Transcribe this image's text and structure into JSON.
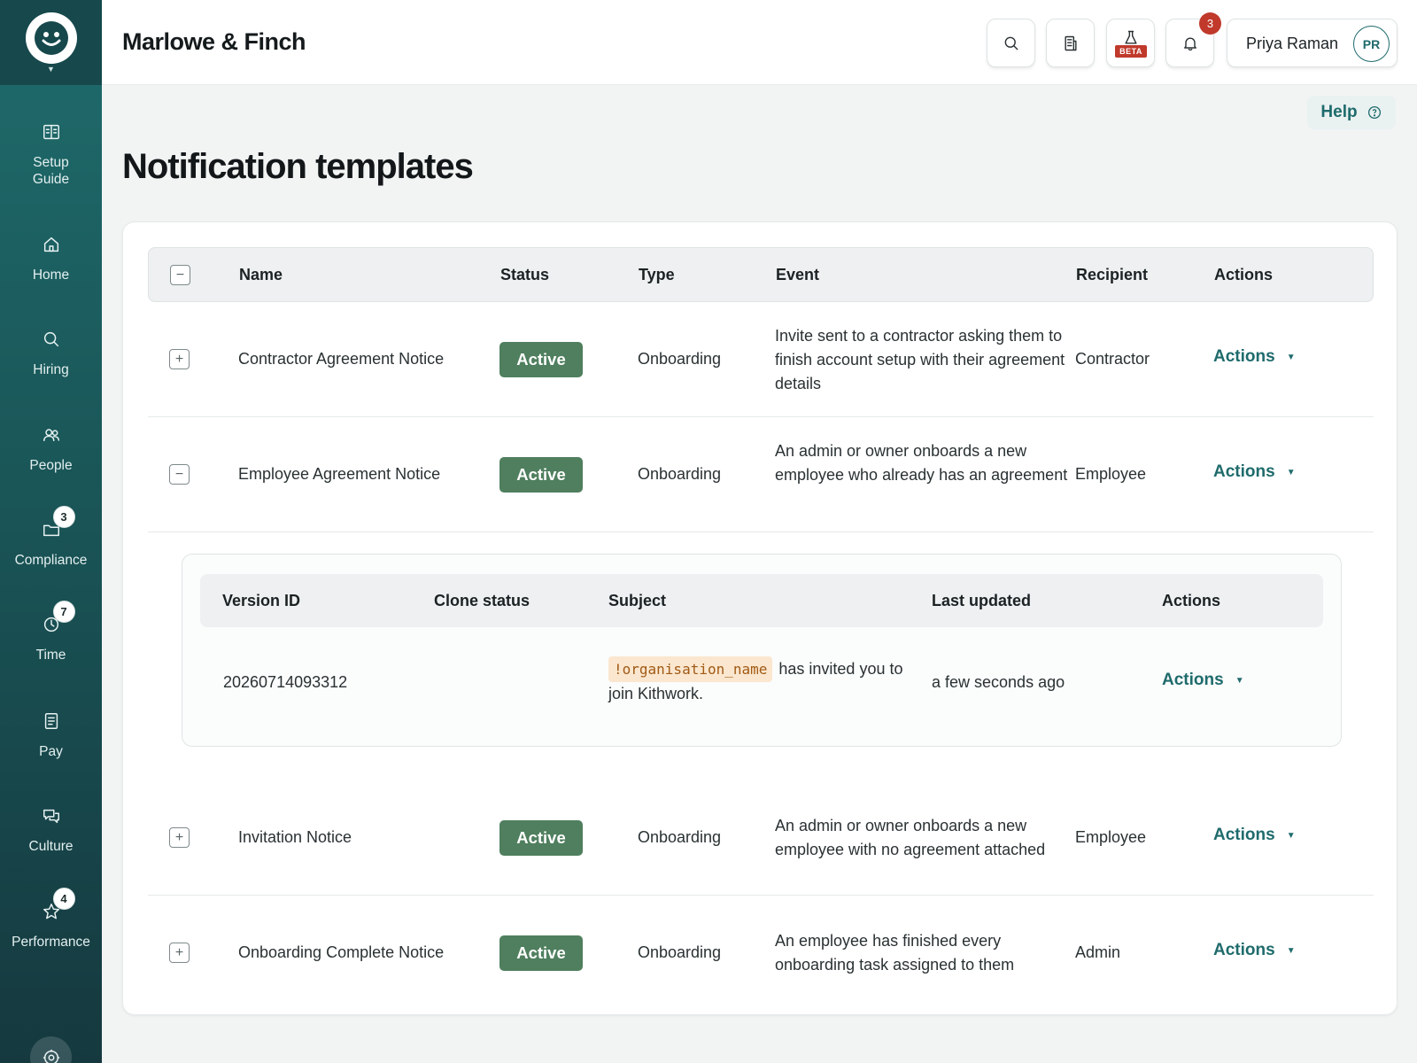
{
  "app": {
    "org_name": "Marlowe & Finch"
  },
  "sidebar": {
    "items": [
      {
        "label": "Setup\nGuide",
        "icon": "book-open-icon"
      },
      {
        "label": "Home",
        "icon": "home-icon"
      },
      {
        "label": "Hiring",
        "icon": "search-icon"
      },
      {
        "label": "People",
        "icon": "people-icon"
      },
      {
        "label": "Compliance",
        "icon": "folder-icon",
        "badge": "3"
      },
      {
        "label": "Time",
        "icon": "clock-icon",
        "badge": "7"
      },
      {
        "label": "Pay",
        "icon": "document-icon"
      },
      {
        "label": "Culture",
        "icon": "chat-icon"
      },
      {
        "label": "Performance",
        "icon": "star-icon",
        "badge": "4"
      }
    ]
  },
  "topbar": {
    "beta_label": "BETA",
    "notification_count": "3",
    "user_name": "Priya Raman",
    "user_initials": "PR"
  },
  "help_label": "Help",
  "page_title": "Notification templates",
  "table": {
    "headers": {
      "name": "Name",
      "status": "Status",
      "type": "Type",
      "event": "Event",
      "recipient": "Recipient",
      "actions": "Actions"
    },
    "rows": [
      {
        "name": "Contractor Agreement Notice",
        "status": "Active",
        "type": "Onboarding",
        "event": "Invite sent to a contractor asking them to finish account setup with their agreement details",
        "recipient": "Contractor",
        "actions": "Actions"
      },
      {
        "name": "Employee Agreement Notice",
        "status": "Active",
        "type": "Onboarding",
        "event": "An admin or owner onboards a new employee who already has an agreement",
        "recipient": "Employee",
        "actions": "Actions"
      },
      {
        "name": "Invitation Notice",
        "status": "Active",
        "type": "Onboarding",
        "event": "An admin or owner onboards a new employee with no agreement attached",
        "recipient": "Employee",
        "actions": "Actions"
      },
      {
        "name": "Onboarding Complete Notice",
        "status": "Active",
        "type": "Onboarding",
        "event": "An employee has finished every onboarding task assigned to them",
        "recipient": "Admin",
        "actions": "Actions"
      }
    ],
    "versions": {
      "headers": {
        "version_id": "Version ID",
        "clone_status": "Clone status",
        "subject": "Subject",
        "last_updated": "Last updated",
        "actions": "Actions"
      },
      "rows": [
        {
          "version_id": "20260714093312",
          "clone_status": "",
          "subject_token": "!organisation_name",
          "subject_text": "has invited you to join Kithwork.",
          "last_updated": "a few seconds ago",
          "actions": "Actions"
        }
      ]
    }
  },
  "colors": {
    "sidebar_top": "#1f6b6c",
    "sidebar_bottom": "#15393f",
    "accent": "#1f6b6c",
    "status_active": "#4f7f5e",
    "badge_red": "#c0392b"
  }
}
